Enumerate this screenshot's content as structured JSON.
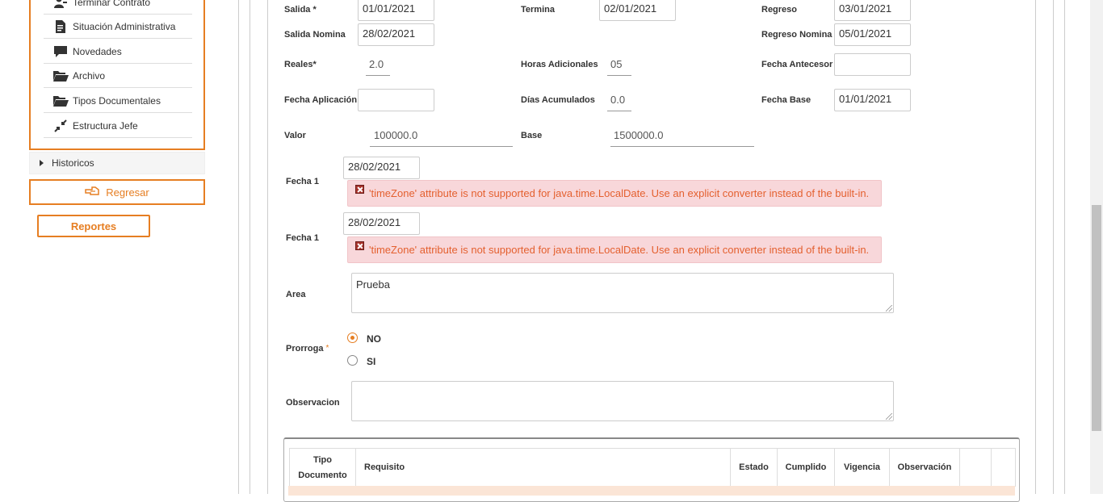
{
  "sidebar": {
    "items": [
      {
        "label": "Terminar Contrato",
        "icon": "user-remove-icon"
      },
      {
        "label": "Situación Administrativa",
        "icon": "document-icon"
      },
      {
        "label": "Novedades",
        "icon": "comment-icon"
      },
      {
        "label": "Archivo",
        "icon": "folder-open-icon"
      },
      {
        "label": "Tipos Documentales",
        "icon": "folder-open-icon"
      },
      {
        "label": "Estructura Jefe",
        "icon": "compress-arrows-icon"
      }
    ],
    "historicos": "Historicos",
    "regresar": "Regresar",
    "reportes": "Reportes"
  },
  "form": {
    "salida_label": "Salida *",
    "salida_value": "01/01/2021",
    "termina_label": "Termina",
    "termina_value": "02/01/2021",
    "regreso_label": "Regreso",
    "regreso_value": "03/01/2021",
    "salida_nomina_label": "Salida Nomina",
    "salida_nomina_value": "28/02/2021",
    "regreso_nomina_label": "Regreso Nomina",
    "regreso_nomina_value": "05/01/2021",
    "reales_label": "Reales*",
    "reales_value": "2.0",
    "horas_adicionales_label": "Horas Adicionales",
    "horas_adicionales_value": "05",
    "fecha_antecesor_label": "Fecha Antecesor",
    "fecha_antecesor_value": "",
    "fecha_aplicacion_label": "Fecha Aplicación",
    "fecha_aplicacion_value": "",
    "dias_acumulados_label": "Días Acumulados",
    "dias_acumulados_value": "0.0",
    "fecha_base_label": "Fecha Base",
    "fecha_base_value": "01/01/2021",
    "valor_label": "Valor",
    "valor_value": "100000.0",
    "base_label": "Base",
    "base_value": "1500000.0",
    "fecha1_label": "Fecha 1",
    "fecha1_value": "28/02/2021",
    "fecha1b_label": "Fecha 1",
    "fecha1b_value": "28/02/2021",
    "error_message": "'timeZone' attribute is not supported for java.time.LocalDate. Use an explicit converter instead of the built-in.",
    "area_label": "Area",
    "area_value": "Prueba",
    "prorroga_label": "Prorroga",
    "prorroga_required": "*",
    "prorroga_options": [
      "NO",
      "SI"
    ],
    "prorroga_selected": "NO",
    "observacion_label": "Observacion",
    "observacion_value": ""
  },
  "table": {
    "headers": [
      "Tipo Documento",
      "Requisito",
      "Estado",
      "Cumplido",
      "Vigencia",
      "Observación",
      "",
      ""
    ]
  },
  "colors": {
    "accent": "#e67e22",
    "error_bg": "#f8d7da",
    "error_text": "#e4602f",
    "row_highlight": "#fbe5d6"
  }
}
